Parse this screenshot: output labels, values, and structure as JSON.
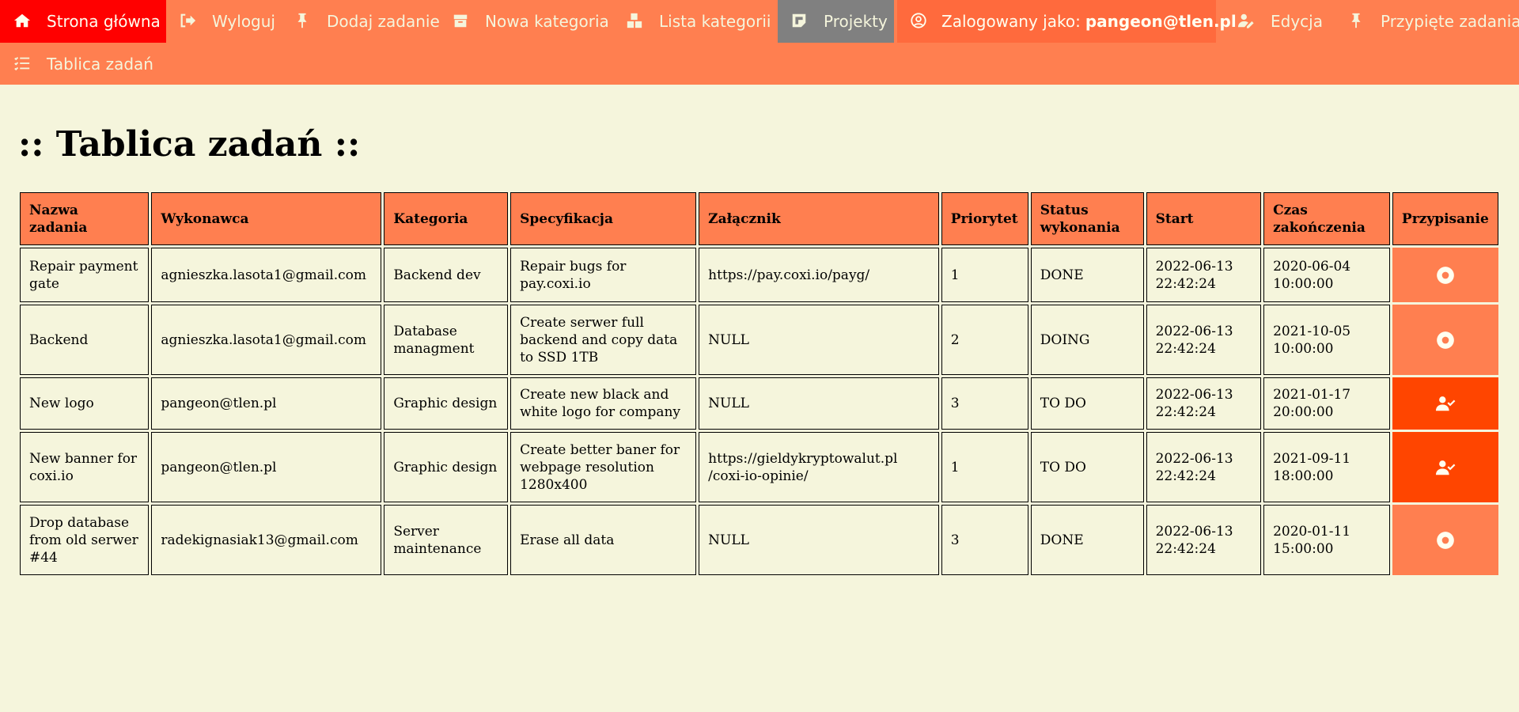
{
  "nav": {
    "home": {
      "label": "Strona główna",
      "icon": "home-icon"
    },
    "logout": {
      "label": "Wyloguj",
      "icon": "sign-out-icon"
    },
    "add_task": {
      "label": "Dodaj zadanie",
      "icon": "pin-icon"
    },
    "new_category": {
      "label": "Nowa kategoria",
      "icon": "box-icon"
    },
    "category_list": {
      "label": "Lista kategorii",
      "icon": "boxes-icon"
    },
    "projects": {
      "label": "Projekty",
      "icon": "note-icon"
    },
    "user": {
      "prefix": "Zalogowany jako:",
      "email": "pangeon@tlen.pl",
      "icon": "user-circle-icon"
    },
    "edit": {
      "label": "Edycja",
      "icon": "user-edit-icon"
    },
    "pinned": {
      "label": "Przypięte zadania",
      "icon": "pin-icon"
    },
    "board": {
      "label": "Tablica zadań",
      "icon": "tasks-list-icon"
    }
  },
  "page": {
    "title": ":: Tablica zadań ::"
  },
  "table": {
    "headers": {
      "name": "Nazwa zadania",
      "executor": "Wykonawca",
      "category": "Kategoria",
      "spec": "Specyfikacja",
      "attachment": "Załącznik",
      "priority": "Priorytet",
      "status": "Status wykonania",
      "start": "Start",
      "end": "Czas zakończenia",
      "assign": "Przypisanie"
    },
    "rows": [
      {
        "name": "Repair payment gate",
        "executor": "agnieszka.lasota1@gmail.com",
        "category": "Backend dev",
        "spec": "Repair bugs for pay.coxi.io",
        "attachment": "https://pay.coxi.io/payg/",
        "priority": "1",
        "status": "DONE",
        "start": "2022-06-13 22:42:24",
        "end": "2020-06-04 10:00:00",
        "assign_icon": "dot-circle-icon"
      },
      {
        "name": "Backend",
        "executor": "agnieszka.lasota1@gmail.com",
        "category": "Database managment",
        "spec": "Create serwer full backend and copy data to SSD 1TB",
        "attachment": "NULL",
        "priority": "2",
        "status": "DOING",
        "start": "2022-06-13 22:42:24",
        "end": "2021-10-05 10:00:00",
        "assign_icon": "dot-circle-icon"
      },
      {
        "name": "New logo",
        "executor": "pangeon@tlen.pl",
        "category": "Graphic design",
        "spec": "Create new black and white logo for company",
        "attachment": "NULL",
        "priority": "3",
        "status": "TO DO",
        "start": "2022-06-13 22:42:24",
        "end": "2021-01-17 20:00:00",
        "assign_icon": "user-check-icon"
      },
      {
        "name": "New banner for coxi.io",
        "executor": "pangeon@tlen.pl",
        "category": "Graphic design",
        "spec": "Create better baner for webpage resolution 1280x400",
        "attachment": "https://gieldykryptowalut.pl /coxi-io-opinie/",
        "priority": "1",
        "status": "TO DO",
        "start": "2022-06-13 22:42:24",
        "end": "2021-09-11 18:00:00",
        "assign_icon": "user-check-icon"
      },
      {
        "name": "Drop database from old serwer #44",
        "executor": "radekignasiak13@gmail.com",
        "category": "Server maintenance",
        "spec": "Erase all data",
        "attachment": "NULL",
        "priority": "3",
        "status": "DONE",
        "start": "2022-06-13 22:42:24",
        "end": "2020-01-11 15:00:00",
        "assign_icon": "dot-circle-icon"
      }
    ]
  },
  "colors": {
    "background": "#f5f5dc",
    "nav": "#ff7f50",
    "home_active": "#ff0000",
    "projects_active": "#808080",
    "user_tab": "#ff6a3d",
    "assigned_self": "#ff4500"
  }
}
